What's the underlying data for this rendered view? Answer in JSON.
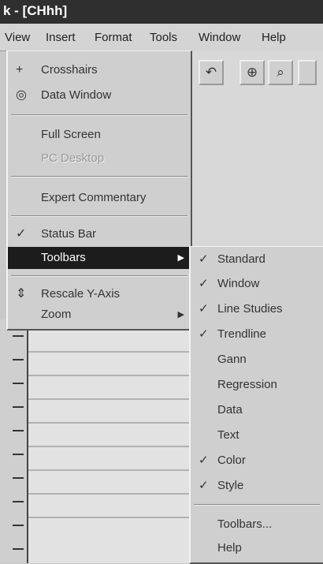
{
  "window": {
    "title": "k - [CHhh]"
  },
  "menubar": [
    "View",
    "Insert",
    "Format",
    "Tools",
    "Window",
    "Help"
  ],
  "toolbar_icons": [
    "undo-icon",
    "crosshairs-icon",
    "zoom-icon"
  ],
  "view_menu": {
    "items": [
      {
        "label": "Crosshairs",
        "icon": "+",
        "name": "crosshairs"
      },
      {
        "label": "Data Window",
        "icon": "◎",
        "name": "data-window"
      },
      {
        "label": "Full Screen",
        "name": "full-screen"
      },
      {
        "label": "PC Desktop",
        "name": "pc-desktop"
      },
      {
        "label": "Expert Commentary",
        "name": "expert-commentary"
      },
      {
        "label": "Status Bar",
        "icon": "✓",
        "name": "status-bar"
      },
      {
        "label": "Toolbars",
        "arrow": "▶",
        "name": "toolbars"
      },
      {
        "label": "Rescale Y-Axis",
        "icon": "⇕",
        "name": "rescale-y-axis"
      },
      {
        "label": "Zoom",
        "arrow": "▶",
        "name": "zoom"
      }
    ]
  },
  "toolbars_submenu": {
    "items": [
      {
        "label": "Standard",
        "checked": "✓"
      },
      {
        "label": "Window",
        "checked": "✓"
      },
      {
        "label": "Line Studies",
        "checked": "✓"
      },
      {
        "label": "Trendline",
        "checked": "✓"
      },
      {
        "label": "Gann",
        "checked": ""
      },
      {
        "label": "Regression",
        "checked": ""
      },
      {
        "label": "Data",
        "checked": ""
      },
      {
        "label": "Text",
        "checked": ""
      },
      {
        "label": "Color",
        "checked": "✓"
      },
      {
        "label": "Style",
        "checked": "✓"
      },
      {
        "label": "Toolbars...",
        "checked": ""
      },
      {
        "label": "Help",
        "checked": ""
      }
    ]
  }
}
